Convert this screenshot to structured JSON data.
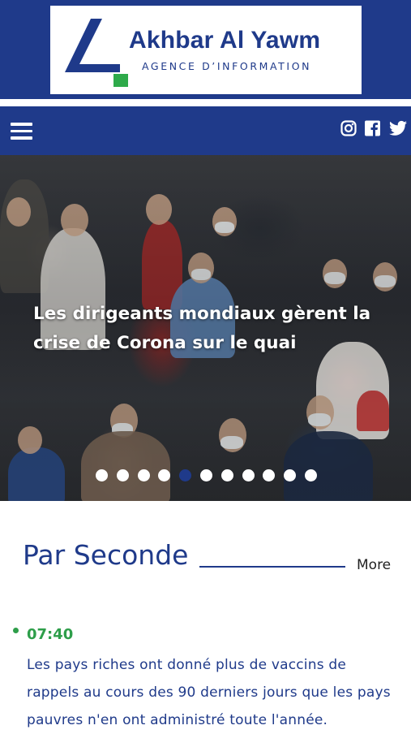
{
  "brand": {
    "name": "Akhbar Al Yawm",
    "tagline": "AGENCE D’INFORMATION",
    "primary_color": "#1f3a8a",
    "accent_color": "#2eaa4a"
  },
  "nav": {
    "menu_icon": "hamburger-menu-icon",
    "social": [
      {
        "name": "instagram-icon"
      },
      {
        "name": "facebook-icon"
      },
      {
        "name": "twitter-icon"
      }
    ]
  },
  "hero": {
    "headline": "Les dirigeants mondiaux gèrent la crise de Corona sur le quai",
    "slide_count": 11,
    "active_slide": 5
  },
  "section": {
    "title": "Par Seconde",
    "more_label": "More"
  },
  "news": [
    {
      "time": "07:40",
      "text": "Les pays riches ont donné plus de vaccins de rappels au cours des 90 derniers jours que les pays pauvres n'en ont administré toute l'année."
    }
  ]
}
